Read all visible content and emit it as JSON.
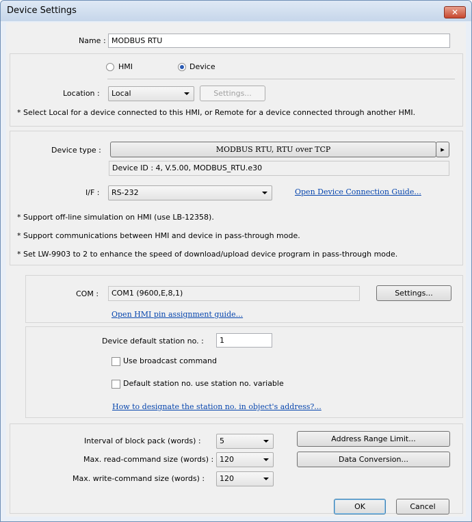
{
  "window": {
    "title": "Device Settings",
    "close_glyph": "✕"
  },
  "name": {
    "label": "Name :",
    "value": "MODBUS RTU"
  },
  "mode": {
    "hmi_label": "HMI",
    "device_label": "Device",
    "selected": "Device"
  },
  "location": {
    "label": "Location :",
    "value": "Local",
    "settings_button": "Settings...",
    "note": "* Select Local for a device connected to this HMI, or Remote for a device connected through another HMI."
  },
  "device": {
    "type_label": "Device type :",
    "type_value": "MODBUS RTU, RTU over TCP",
    "type_arrow": "▸",
    "info": "Device ID : 4, V.5.00, MODBUS_RTU.e30",
    "if_label": "I/F :",
    "if_value": "RS-232",
    "connection_guide_link": "Open Device Connection Guide...",
    "notes": [
      "* Support off-line simulation on HMI (use LB-12358).",
      "* Support communications between HMI and device in pass-through mode.",
      "* Set LW-9903 to 2 to enhance the speed of download/upload device program in pass-through mode."
    ]
  },
  "com": {
    "label": "COM :",
    "value": "COM1 (9600,E,8,1)",
    "settings_button": "Settings...",
    "pin_guide_link": "Open HMI pin assignment guide..."
  },
  "station": {
    "default_label": "Device default station no. :",
    "default_value": "1",
    "broadcast_label": "Use broadcast command",
    "broadcast_checked": false,
    "variable_label": "Default station no. use station no. variable",
    "variable_checked": false,
    "howto_link": "How to designate the station no. in object's address?..."
  },
  "block": {
    "interval_label": "Interval of block pack (words) :",
    "interval_value": "5",
    "max_read_label": "Max. read-command size (words) :",
    "max_read_value": "120",
    "max_write_label": "Max. write-command size (words) :",
    "max_write_value": "120",
    "address_range_button": "Address Range Limit...",
    "data_conversion_button": "Data Conversion..."
  },
  "footer": {
    "ok_button": "OK",
    "cancel_button": "Cancel"
  }
}
